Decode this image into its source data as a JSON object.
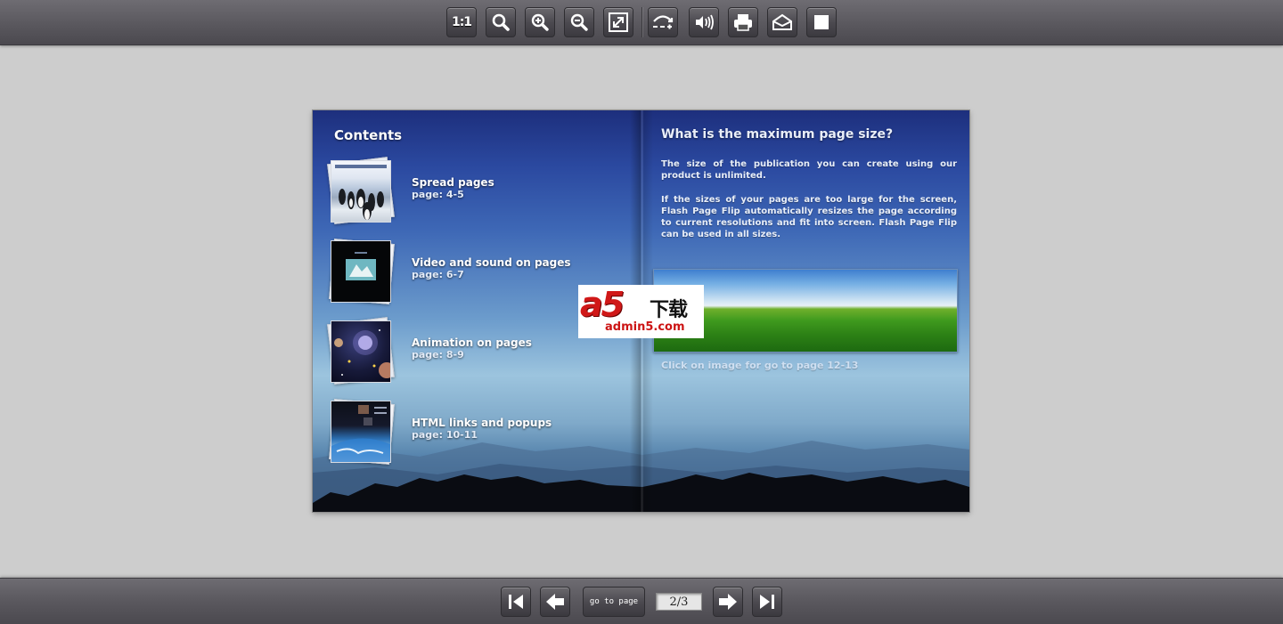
{
  "toolbar_top": {
    "buttons": [
      {
        "name": "actual-size-button",
        "icon": "ratio-1-1-icon",
        "label": "1:1"
      },
      {
        "name": "zoom-button",
        "icon": "magnifier-icon"
      },
      {
        "name": "zoom-in-button",
        "icon": "zoom-in-icon"
      },
      {
        "name": "zoom-out-button",
        "icon": "zoom-out-icon"
      },
      {
        "name": "fullscreen-button",
        "icon": "expand-icon"
      },
      {
        "name": "auto-flip-button",
        "icon": "flip-icon"
      },
      {
        "name": "sound-button",
        "icon": "speaker-icon"
      },
      {
        "name": "print-button",
        "icon": "printer-icon"
      },
      {
        "name": "email-button",
        "icon": "envelope-icon"
      },
      {
        "name": "stop-button",
        "icon": "square-icon"
      }
    ]
  },
  "book": {
    "left_page": {
      "heading": "Contents",
      "items": [
        {
          "title": "Spread pages",
          "page": "page: 4-5",
          "thumb_icon": "penguins-thumbnail"
        },
        {
          "title": "Video and sound on pages",
          "page": "page: 6-7",
          "thumb_icon": "video-thumbnail"
        },
        {
          "title": "Animation on pages",
          "page": "page: 8-9",
          "thumb_icon": "space-thumbnail"
        },
        {
          "title": "HTML links and popups",
          "page": "page: 10-11",
          "thumb_icon": "earth-thumbnail"
        }
      ]
    },
    "right_page": {
      "heading": "What is the maximum page size?",
      "paragraph1": "The size of the publication you can create using our product is unlimited.",
      "paragraph2": "If the sizes of your pages are too large for the screen, Flash Page Flip automatically resizes the page according to current resolutions and fit into screen. Flash Page Flip can be used in all sizes.",
      "image_icon": "green-field-image",
      "caption": "Click on image for go to page 12-13"
    }
  },
  "watermark": {
    "brand": "a5",
    "chinese": "下载",
    "url": "admin5.com"
  },
  "toolbar_bottom": {
    "goto_label": "go to page",
    "page_value": "2/3"
  },
  "colors": {
    "toolbar": "#5a585e",
    "background": "#cdcdcd",
    "watermark_red": "#d01818"
  }
}
